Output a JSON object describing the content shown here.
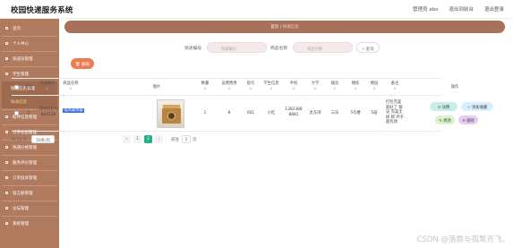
{
  "header": {
    "title": "校园快递服务系统",
    "user_text": "管理员 abo",
    "front_link": "退出到前台",
    "logout": "退出登录"
  },
  "sidebar": {
    "items": [
      {
        "label": "首页"
      },
      {
        "label": "个人中心"
      },
      {
        "label": "快递员管理"
      },
      {
        "label": "学生管理"
      },
      {
        "label": "快递信息管理"
      },
      {
        "label": "快递信息"
      },
      {
        "label": "取件信息管理"
      },
      {
        "label": "订单状态管理"
      },
      {
        "label": "快递价格管理"
      },
      {
        "label": "服务评价管理"
      },
      {
        "label": "订单投诉管理"
      },
      {
        "label": "留言板管理"
      },
      {
        "label": "论坛管理"
      },
      {
        "label": "系统管理"
      }
    ]
  },
  "breadcrumb": {
    "home": "首页",
    "sep": "/",
    "current": "快递信息"
  },
  "search": {
    "field1_label": "快递编号",
    "field1_placeholder": "快递编号",
    "field2_label": "商品名称",
    "field2_placeholder": "商品名称",
    "search_button": "查询"
  },
  "actions": {
    "delete_button": "删除"
  },
  "table": {
    "headers": [
      {
        "label": "索引"
      },
      {
        "label": "快递编号",
        "sortable": true
      },
      {
        "label": "商品名称",
        "sortable": true
      },
      {
        "label": "图片",
        "sortable": false
      },
      {
        "label": "数量",
        "sortable": true
      },
      {
        "label": "运费费用",
        "sortable": true
      },
      {
        "label": "宿号",
        "sortable": true
      },
      {
        "label": "学生信息",
        "sortable": true
      },
      {
        "label": "手机",
        "sortable": true
      },
      {
        "label": "大学",
        "sortable": true
      },
      {
        "label": "寝舍",
        "sortable": true
      },
      {
        "label": "楼栋",
        "sortable": true
      },
      {
        "label": "楼层",
        "sortable": true
      },
      {
        "label": "备注",
        "sortable": true
      },
      {
        "label": "操作",
        "sortable": false
      }
    ],
    "rows": [
      {
        "index": "1",
        "code_line1": "16945670",
        "code_line2": "844338",
        "goods_name": "电风扇水器",
        "quantity": "1",
        "fee": "8",
        "room_no": "001",
        "student": "小红",
        "phone_line1": "1382388",
        "phone_line2": "8881",
        "university": "太东湾",
        "dorm": "三乐",
        "building": "5号楼",
        "floor": "5层",
        "remark_line1": "打包完美",
        "remark_line2": "就好了 保",
        "remark_line3": "证 完美无",
        "remark_line4": "损 即 坏于",
        "remark_line5": "面包场",
        "ops": {
          "detail": "详情",
          "pay": "添加收藏",
          "edit": "修改",
          "del": "删除"
        }
      }
    ]
  },
  "pager": {
    "total": "共 11 条",
    "page_size": "10条/页",
    "prev": "‹",
    "page1": "1",
    "page2": "2",
    "next": "›",
    "goto_label": "前往",
    "goto_value": "2",
    "goto_suffix": "页"
  },
  "watermark": "CSDN @落霞与孤鹜齐飞。",
  "colors": {
    "sidebar": "#b07a5e",
    "breadcrumb": "#a8725a",
    "delete": "#f07a52",
    "active_page": "#21b087"
  }
}
